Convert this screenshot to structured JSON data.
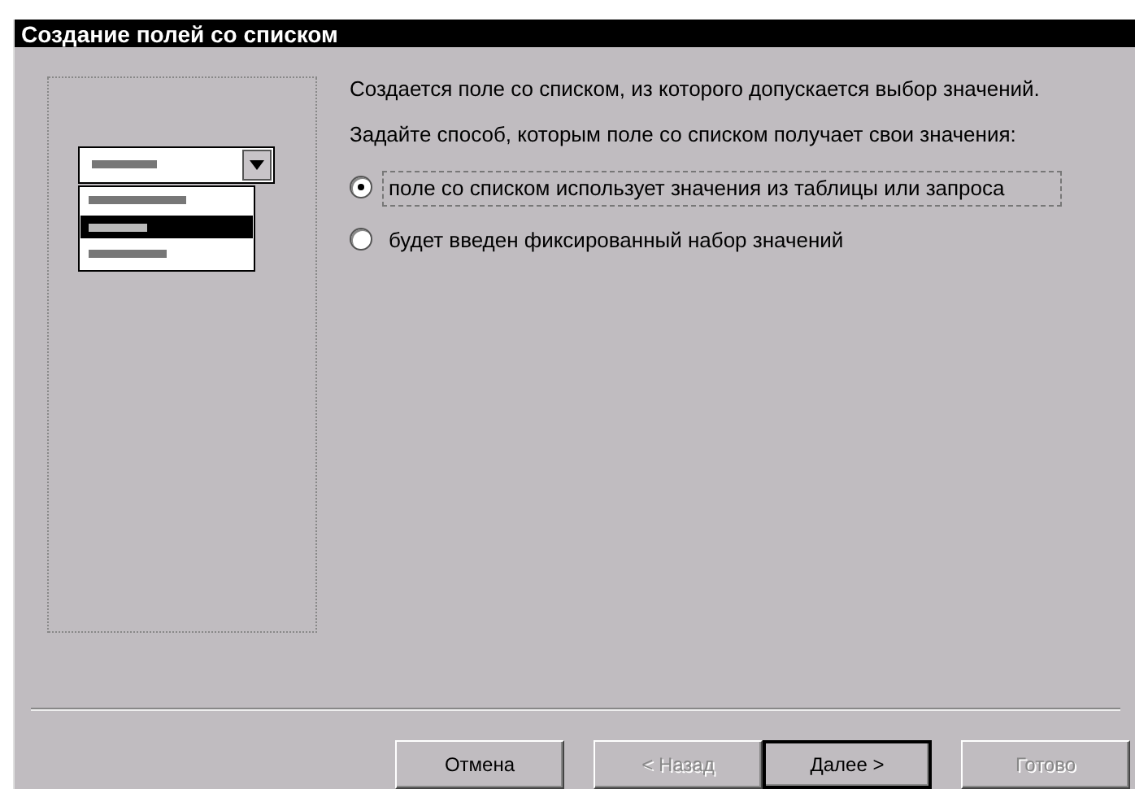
{
  "window": {
    "title": "Создание полей со списком"
  },
  "description": [
    "Создается поле со списком, из которого допускается выбор значений.",
    "Задайте способ, которым поле со списком получает свои значения:"
  ],
  "options": [
    {
      "label": "поле со списком использует значения из таблицы или запроса",
      "selected": true
    },
    {
      "label": "будет введен фиксированный набор значений",
      "selected": false
    }
  ],
  "buttons": [
    {
      "label": "Отмена",
      "disabled": false,
      "default": false
    },
    {
      "label": "< Назад",
      "disabled": true,
      "default": false
    },
    {
      "label": "Далее >",
      "disabled": false,
      "default": true
    },
    {
      "label": "Готово",
      "disabled": true,
      "default": false
    }
  ]
}
